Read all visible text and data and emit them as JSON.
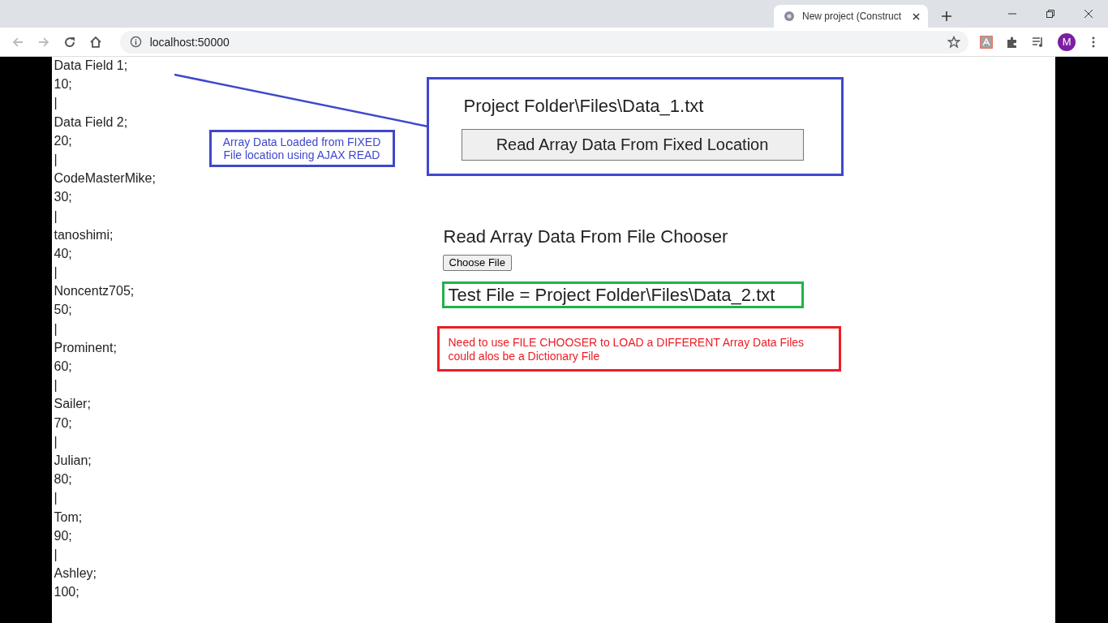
{
  "browser": {
    "tab_title": "New project (Construct",
    "url": "localhost:50000",
    "avatar": "M"
  },
  "data_lines": [
    "Data Field 1;",
    "10;",
    "|",
    "Data Field 2;",
    "20;",
    "|",
    "CodeMasterMike;",
    "30;",
    "|",
    "tanoshimi;",
    "40;",
    "|",
    "Noncentz705;",
    "50;",
    "|",
    "Prominent;",
    "60;",
    "|",
    "Sailer;",
    "70;",
    "|",
    "Julian;",
    "80;",
    "|",
    "Tom;",
    "90;",
    "|",
    "Ashley;",
    "100;"
  ],
  "fixed_note": "Array Data Loaded from FIXED File location using AJAX READ",
  "fixed_panel": {
    "path": "Project Folder\\Files\\Data_1.txt",
    "button": "Read Array Data From Fixed Location"
  },
  "chooser": {
    "heading": "Read Array Data From File Chooser",
    "button": "Choose File"
  },
  "test_file": "Test File = Project Folder\\Files\\Data_2.txt",
  "red_note": [
    "Need to use FILE CHOOSER to LOAD a DIFFERENT Array Data Files",
    "could alos be a Dictionary File"
  ]
}
